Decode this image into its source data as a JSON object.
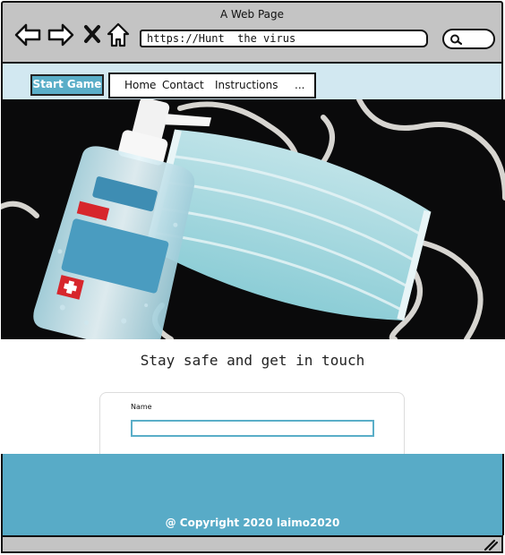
{
  "window": {
    "title": "A Web Page"
  },
  "browser": {
    "url": "https://Hunt  the virus",
    "icons": [
      "back-arrow-icon",
      "forward-arrow-icon",
      "close-x-icon",
      "home-icon",
      "search-icon"
    ]
  },
  "site_nav": {
    "start_button": "Start Game",
    "menu": [
      "Home",
      "Contact",
      "Instructions",
      "..."
    ]
  },
  "contact": {
    "headline": "Stay safe and get in touch",
    "name_label": "Name",
    "name_value": ""
  },
  "footer": {
    "copyright": "@ Copyright 2020 laimo2020"
  },
  "colors": {
    "accent": "#58abc7",
    "nav_bg": "#d2e8f1",
    "chrome_gray": "#c4c4c4"
  }
}
